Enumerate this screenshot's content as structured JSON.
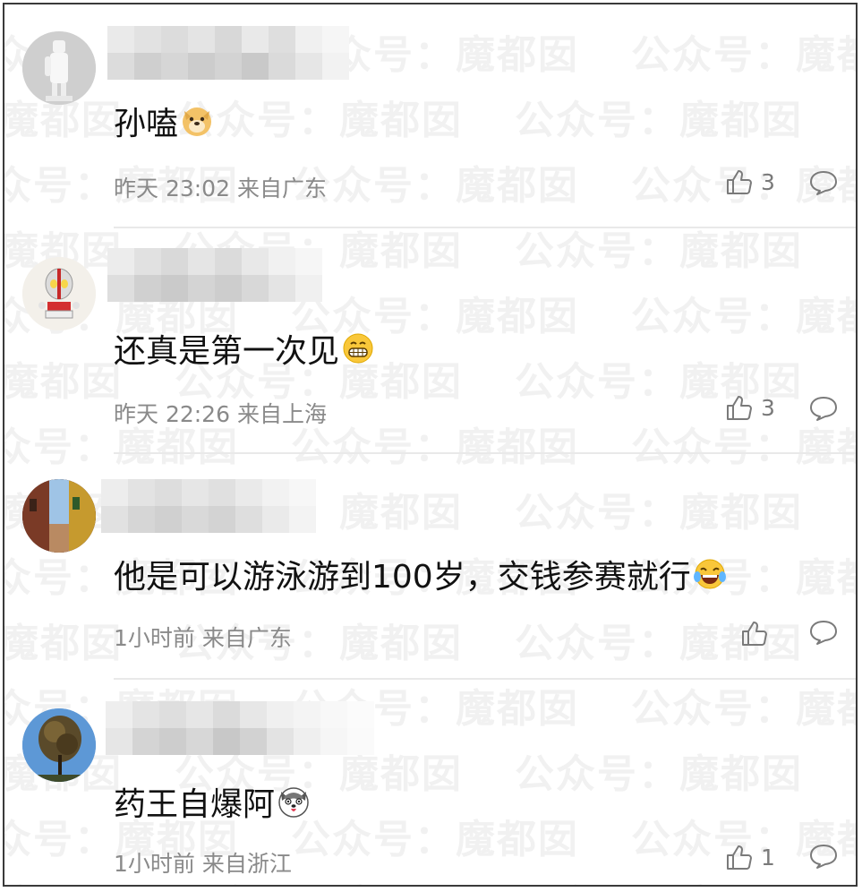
{
  "watermark": "公众号：魔都囡",
  "comments": [
    {
      "content": "孙嗑",
      "emoji_icon": "doge-emoji-icon",
      "time": "昨天 23:02",
      "location": "来自广东",
      "likes": "3"
    },
    {
      "content": "还真是第一次见",
      "emoji_icon": "grin-emoji-icon",
      "time": "昨天 22:26",
      "location": "来自上海",
      "likes": "3"
    },
    {
      "content": "他是可以游泳游到100岁，交钱参赛就行",
      "emoji_icon": "laugh-cry-emoji-icon",
      "time": "1小时前",
      "location": "来自广东",
      "likes": ""
    },
    {
      "content": "药王自爆阿",
      "emoji_icon": "husky-emoji-icon",
      "time": "1小时前",
      "location": "来自浙江",
      "likes": "1"
    }
  ],
  "colors": {
    "text": "#111111",
    "meta": "#8a8a8a",
    "icon": "#7a7a7a",
    "divider": "#e9e9e9"
  }
}
